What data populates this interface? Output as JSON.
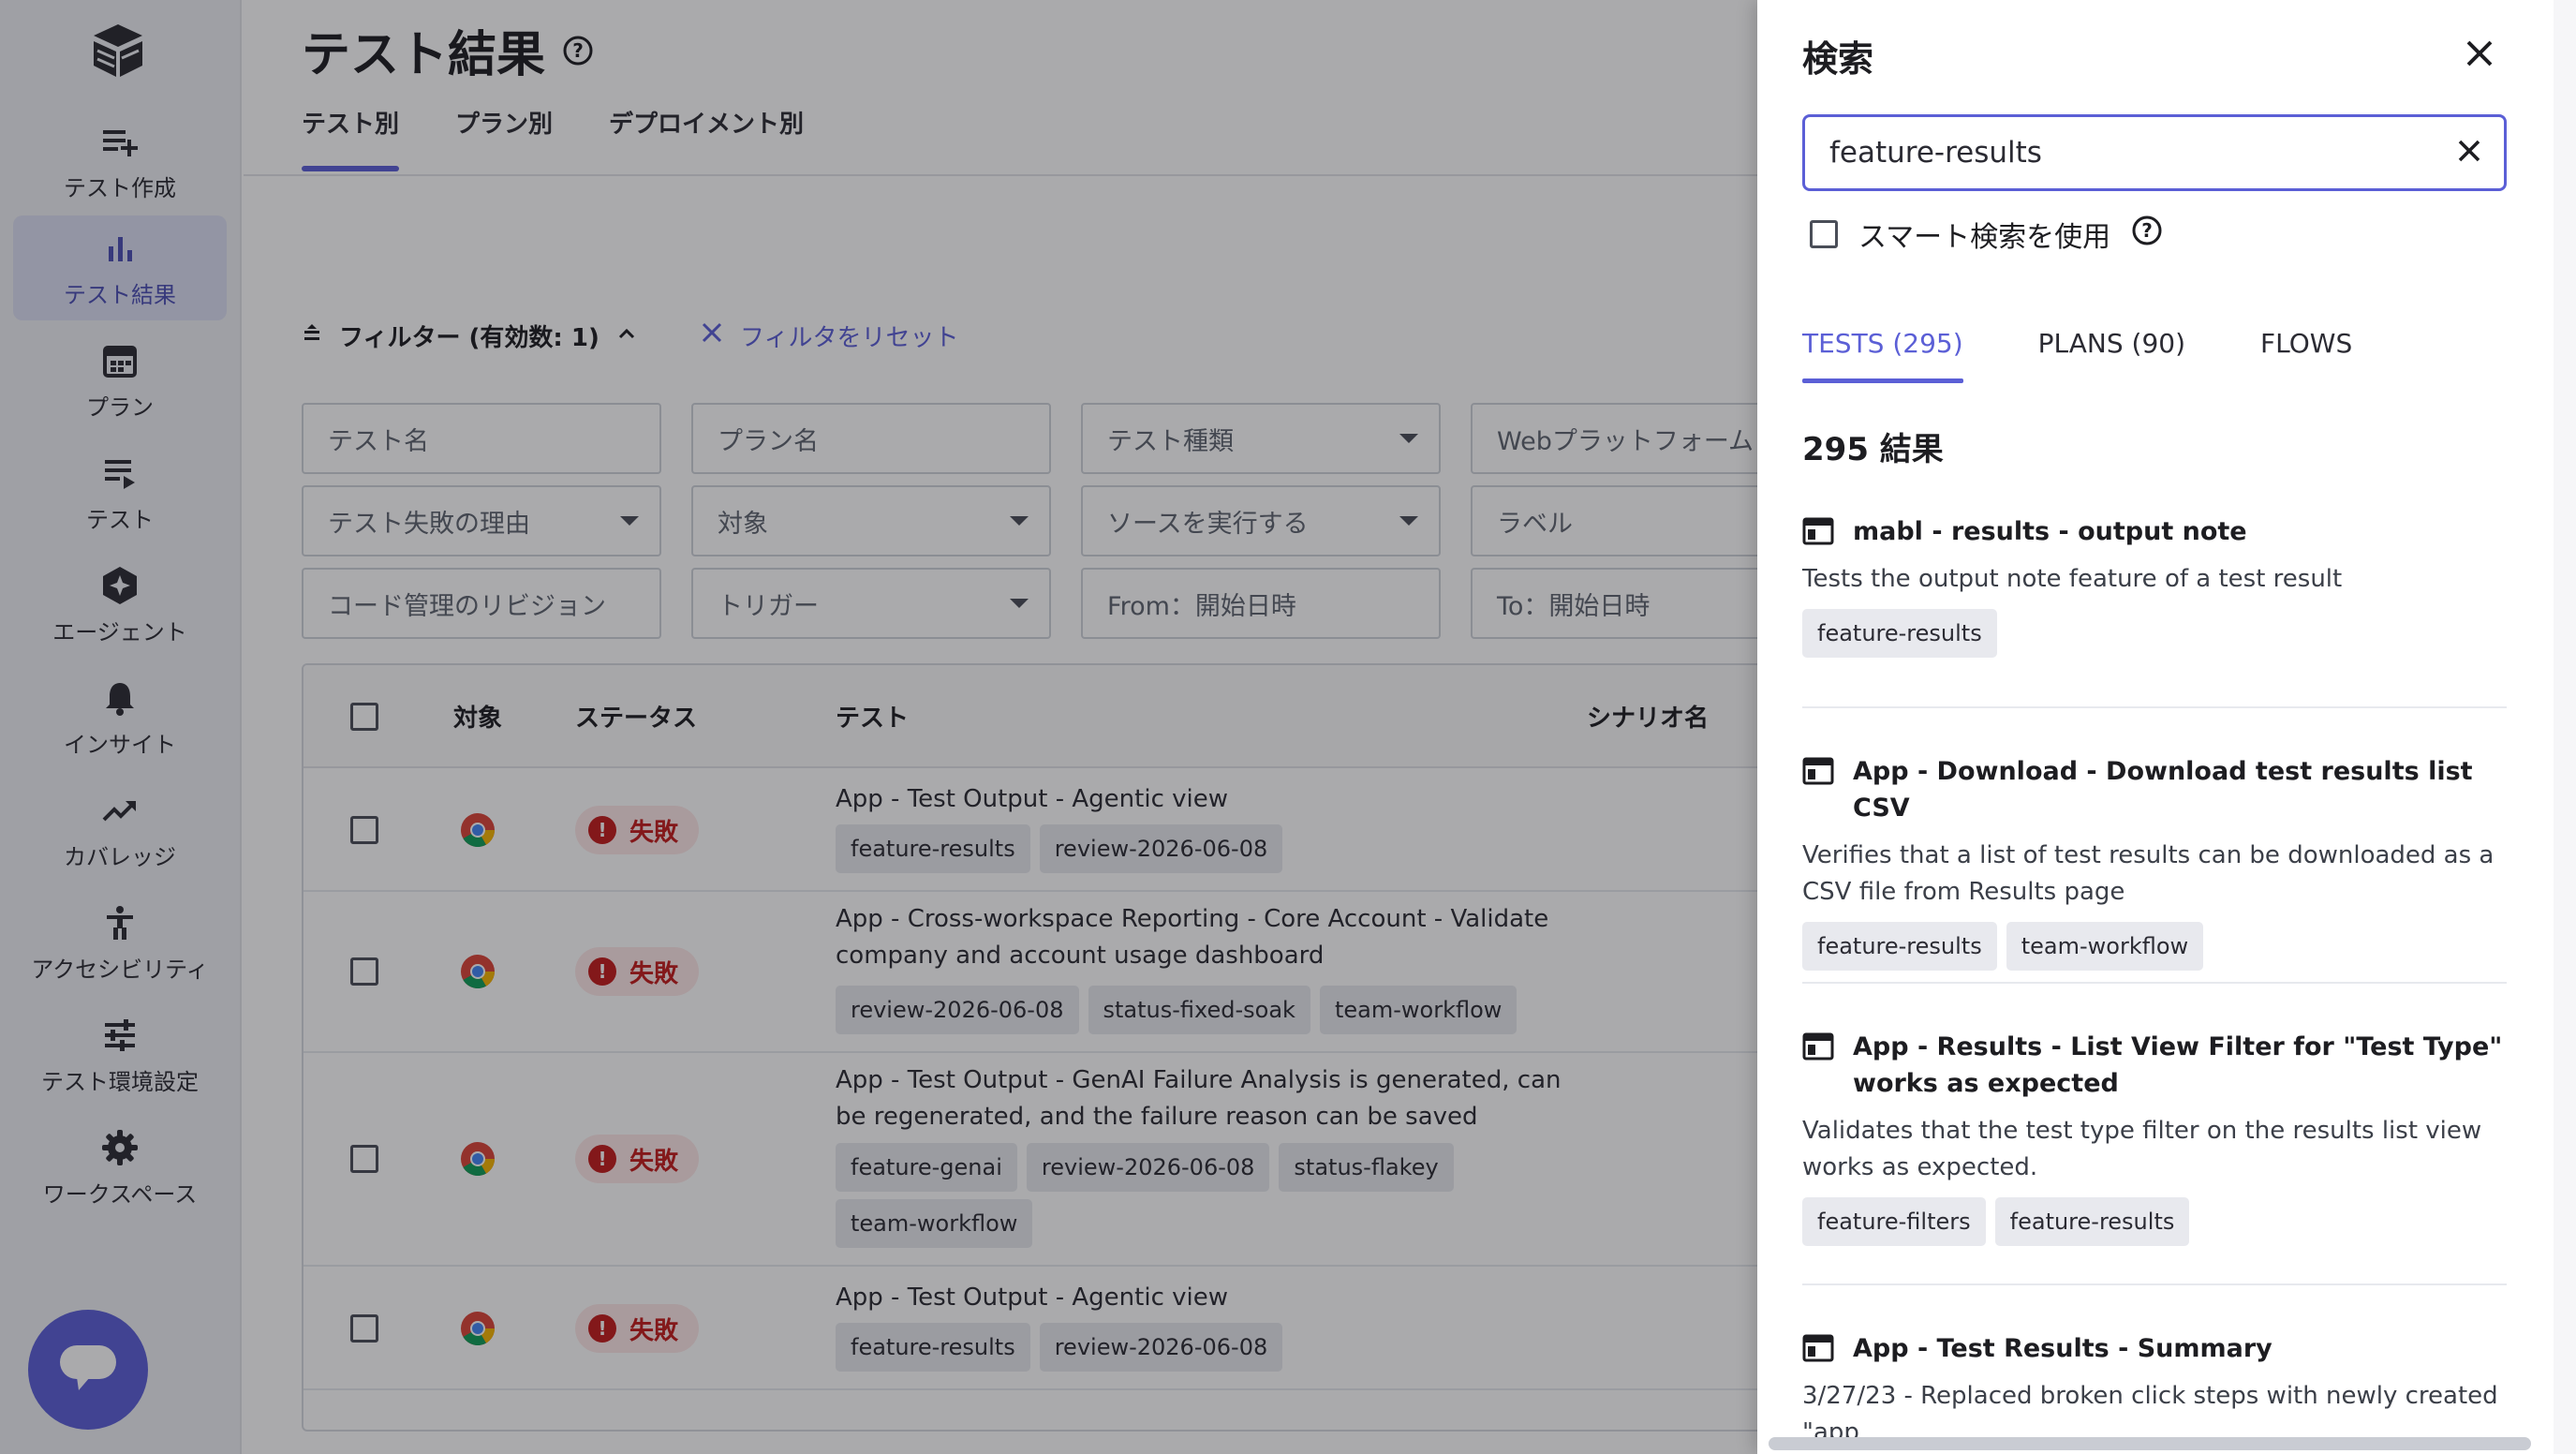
{
  "sidebar": {
    "items": [
      {
        "label": "テスト作成",
        "icon": "playlist-add-icon"
      },
      {
        "label": "テスト結果",
        "icon": "bar-chart-icon"
      },
      {
        "label": "プラン",
        "icon": "calendar-icon"
      },
      {
        "label": "テスト",
        "icon": "list-play-icon"
      },
      {
        "label": "エージェント",
        "icon": "sparkle-hexagon-icon"
      },
      {
        "label": "インサイト",
        "icon": "bell-icon"
      },
      {
        "label": "カバレッジ",
        "icon": "trending-up-icon"
      },
      {
        "label": "アクセシビリティ",
        "icon": "accessibility-icon"
      },
      {
        "label": "テスト環境設定",
        "icon": "sliders-icon"
      },
      {
        "label": "ワークスペース",
        "icon": "gear-icon"
      }
    ],
    "active_index": 1
  },
  "header": {
    "title": "テスト結果",
    "tabs": [
      "テスト別",
      "プラン別",
      "デプロイメント別"
    ],
    "active_tab": 0
  },
  "filters": {
    "header": "フィルター (有効数: 1)",
    "reset": "フィルタをリセット",
    "fields": [
      "テスト名",
      "プラン名",
      "テスト種類",
      "Webプラットフォーム",
      "テスト失敗の理由",
      "対象",
      "ソースを実行する",
      "ラベル",
      "コード管理のリビジョン",
      "トリガー",
      "From：開始日時",
      "To：開始日時"
    ]
  },
  "table": {
    "columns": [
      "対象",
      "ステータス",
      "テスト",
      "シナリオ名"
    ],
    "rows": [
      {
        "status": "失敗",
        "title": "App - Test Output - Agentic view",
        "labels": [
          "feature-results",
          "review-2026-06-08"
        ]
      },
      {
        "status": "失敗",
        "title": "App - Cross-workspace Reporting - Core Account - Validate company and account usage dashboard",
        "labels": [
          "review-2026-06-08",
          "status-fixed-soak",
          "team-workflow"
        ]
      },
      {
        "status": "失敗",
        "title": "App - Test Output - GenAI Failure Analysis is generated, can be regenerated, and the failure reason can be saved",
        "labels": [
          "feature-genai",
          "review-2026-06-08",
          "status-flakey",
          "team-workflow"
        ]
      },
      {
        "status": "失敗",
        "title": "App - Test Output - Agentic view",
        "labels": [
          "feature-results",
          "review-2026-06-08"
        ]
      }
    ]
  },
  "search": {
    "title": "検索",
    "query": "feature-results",
    "smart_search_label": "スマート検索を使用",
    "tabs": [
      "TESTS (295)",
      "PLANS (90)",
      "FLOWS"
    ],
    "active_tab": 0,
    "count_label": "295 結果",
    "results": [
      {
        "title": "mabl - results - output note",
        "description": "Tests the output note feature of a test result",
        "labels": [
          "feature-results"
        ]
      },
      {
        "title": "App - Download - Download test results list CSV",
        "description": "Verifies that a list of test results can be downloaded as a CSV file from Results page",
        "labels": [
          "feature-results",
          "team-workflow"
        ]
      },
      {
        "title": "App - Results - List View Filter for \"Test Type\" works as expected",
        "description": "Validates that the test type filter on the results list view works as expected.",
        "labels": [
          "feature-filters",
          "feature-results"
        ]
      },
      {
        "title": "App - Test Results - Summary",
        "description": "3/27/23 - Replaced broken click steps with newly created \"app",
        "labels": []
      }
    ]
  },
  "colors": {
    "accent": "#5b5fd6",
    "failed": "#c21b1b",
    "failed_bg": "#fde8e8"
  }
}
